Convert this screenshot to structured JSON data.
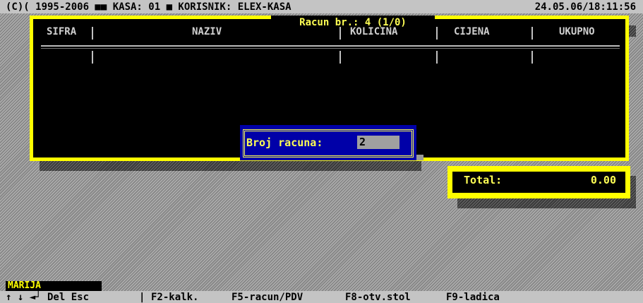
{
  "header": {
    "left_text": "(C)( 1995-2006 ■■ KASA: 01 ■ KORISNIK: ELEX-KASA",
    "datetime": "24.05.06/18:11:56"
  },
  "receipt": {
    "title": "Racun br.: 4 (1/0)",
    "columns": [
      "SIFRA",
      "NAZIV",
      "KOLICINA",
      "CIJENA",
      "UKUPNO"
    ],
    "rows": []
  },
  "dialog": {
    "label": "Broj racuna:",
    "value": "2"
  },
  "total": {
    "label": "Total:",
    "value": "0.00"
  },
  "user": {
    "name": "MARIJA"
  },
  "status_bar": {
    "keys": [
      "↑ ↓ ◄┘ Del Esc",
      "|",
      "F2-kalk.",
      "F5-racun/PDV",
      "F8-otv.stol",
      "F9-ladica"
    ]
  },
  "colors": {
    "frame_yellow": "#ffff00",
    "dialog_blue": "#0000a8",
    "bar_gray": "#c4c4c4"
  }
}
